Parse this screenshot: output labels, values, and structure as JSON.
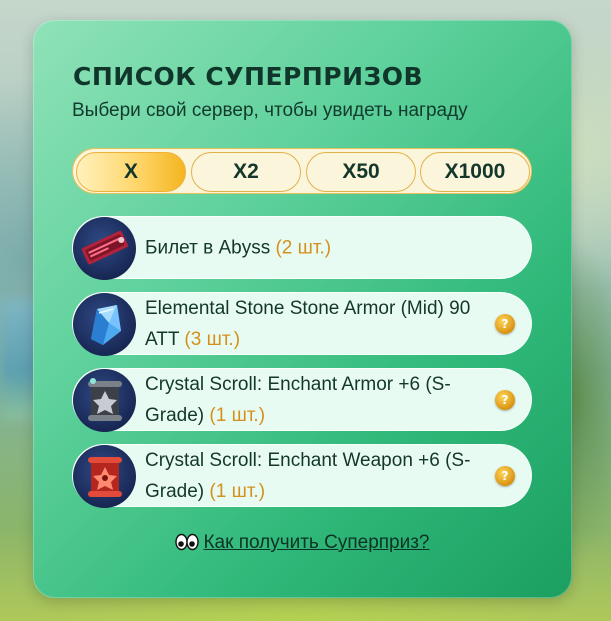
{
  "title": "СПИСОК СУПЕРПРИЗОВ",
  "subtitle": "Выбери свой сервер, чтобы увидеть награду",
  "tabs": [
    {
      "label": "X",
      "active": true
    },
    {
      "label": "X2",
      "active": false
    },
    {
      "label": "X50",
      "active": false
    },
    {
      "label": "X1000",
      "active": false
    }
  ],
  "items": [
    {
      "name": "Билет в Abyss",
      "qty": "(2 шт.)",
      "icon": "abyss-ticket-icon",
      "has_help": false
    },
    {
      "name": "Elemental Stone Stone Armor (Mid) 90 ATT",
      "qty": "(3 шт.)",
      "icon": "elemental-stone-icon",
      "has_help": true
    },
    {
      "name": "Crystal Scroll: Enchant Armor +6 (S-Grade)",
      "qty": "(1 шт.)",
      "icon": "armor-scroll-icon",
      "has_help": true
    },
    {
      "name": "Crystal Scroll: Enchant Weapon +6 (S-Grade)",
      "qty": "(1 шт.)",
      "icon": "weapon-scroll-icon",
      "has_help": true
    }
  ],
  "help_symbol": "?",
  "how_link": "Как получить Суперприз?",
  "colors": {
    "panel_start": "#8fe2b8",
    "panel_end": "#1c9f61",
    "tab_active": "#f4b521",
    "quantity": "#d3901b",
    "item_bg": "#e8fbf2"
  }
}
